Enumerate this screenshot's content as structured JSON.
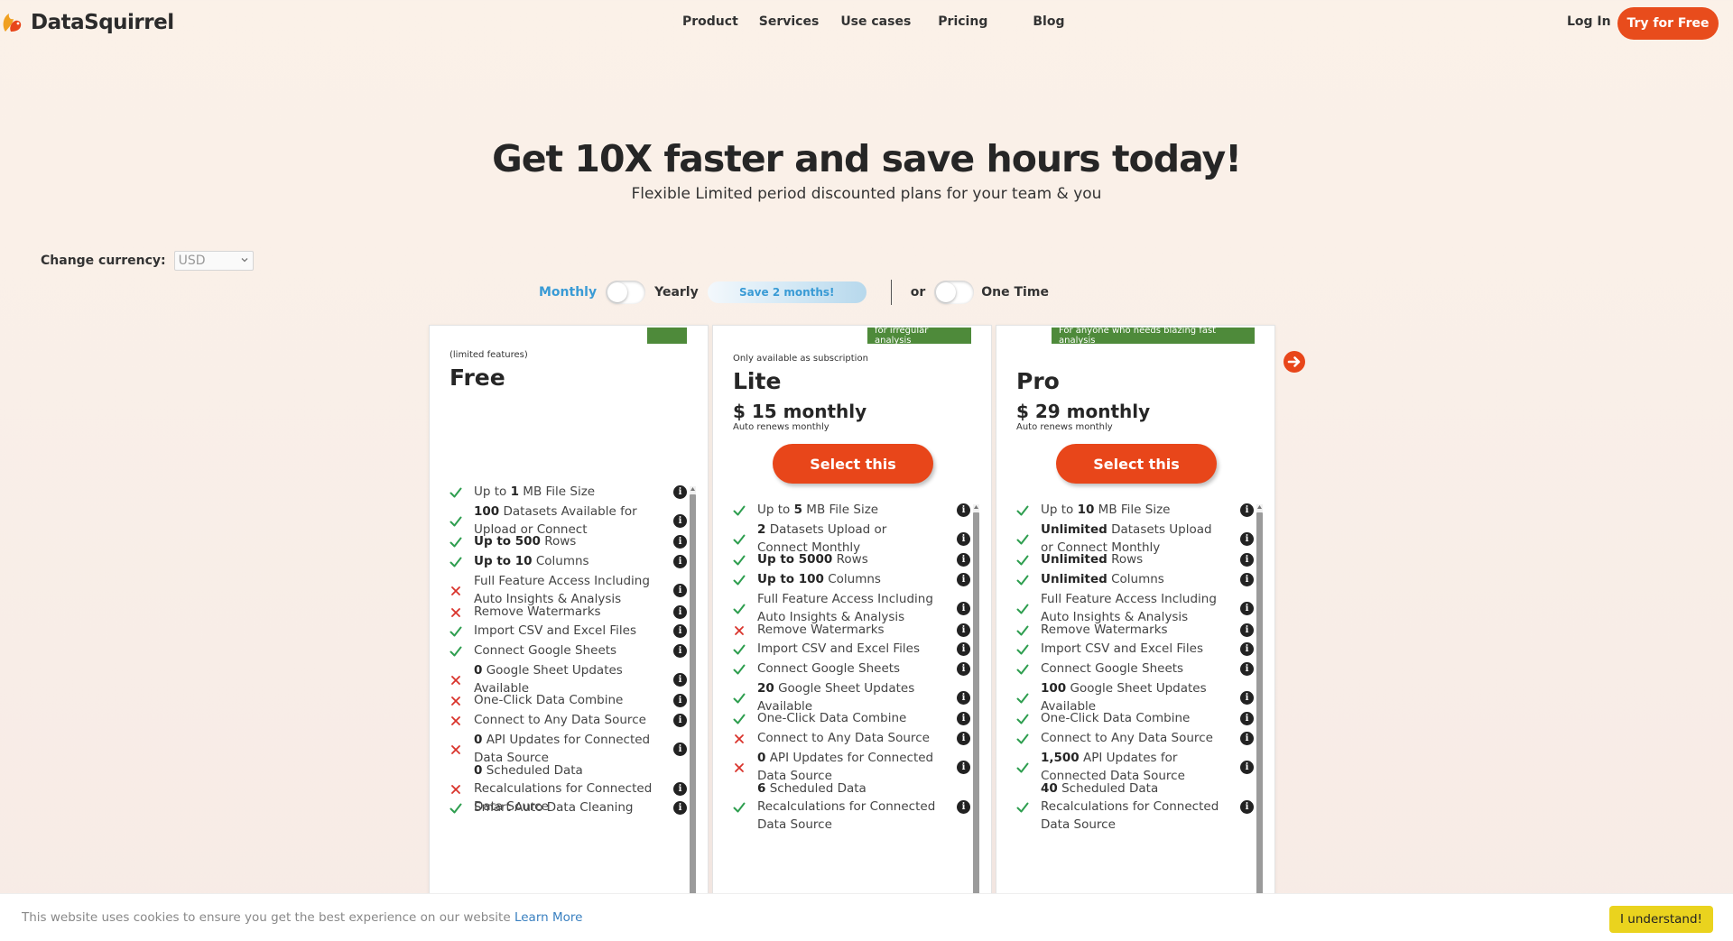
{
  "brand": {
    "name": "DataSquirrel"
  },
  "nav": {
    "items": [
      "Product",
      "Services",
      "Use cases",
      "Pricing",
      "Blog"
    ],
    "login": "Log In",
    "cta": "Try for Free"
  },
  "hero": {
    "title": "Get 10X faster and save hours today!",
    "subtitle": "Flexible Limited period discounted plans for your team & you"
  },
  "currency": {
    "label": "Change currency:",
    "value": "USD"
  },
  "billing": {
    "monthly": "Monthly",
    "yearly": "Yearly",
    "save_badge": "Save 2 months!",
    "or": "or",
    "one_time": "One Time"
  },
  "plans": [
    {
      "badge": "",
      "note": "(limited features)",
      "name": "Free",
      "features": [
        {
          "ok": true,
          "pre": "Up to ",
          "bold": "1",
          "post": " MB File Size"
        },
        {
          "ok": true,
          "pre": "",
          "bold": "100",
          "post": " Datasets Available for Upload or Connect"
        },
        {
          "ok": true,
          "pre": "",
          "bold": "Up to 500",
          "post": " Rows"
        },
        {
          "ok": true,
          "pre": "",
          "bold": "Up to 10",
          "post": " Columns"
        },
        {
          "ok": false,
          "pre": "Full Feature Access Including Auto Insights & Analysis",
          "bold": "",
          "post": ""
        },
        {
          "ok": false,
          "pre": "Remove Watermarks",
          "bold": "",
          "post": ""
        },
        {
          "ok": true,
          "pre": "Import CSV and Excel Files",
          "bold": "",
          "post": ""
        },
        {
          "ok": true,
          "pre": "Connect Google Sheets",
          "bold": "",
          "post": ""
        },
        {
          "ok": false,
          "pre": "",
          "bold": "0",
          "post": " Google Sheet Updates Available"
        },
        {
          "ok": false,
          "pre": "One-Click Data Combine",
          "bold": "",
          "post": ""
        },
        {
          "ok": false,
          "pre": "Connect to Any Data Source",
          "bold": "",
          "post": ""
        },
        {
          "ok": false,
          "pre": "",
          "bold": "0",
          "post": " API Updates for Connected Data Source"
        },
        {
          "ok": false,
          "pre": "",
          "bold": "0",
          "post": " Scheduled Data Recalculations for Connected Data Source"
        },
        {
          "ok": true,
          "pre": "Smart Auto Data Cleaning",
          "bold": "",
          "post": ""
        }
      ]
    },
    {
      "badge": "for irregular analysis",
      "note": "Only available as subscription",
      "name": "Lite",
      "price": "$ 15 monthly",
      "renew": "Auto renews monthly",
      "button": "Select this",
      "features": [
        {
          "ok": true,
          "pre": "Up to ",
          "bold": "5",
          "post": " MB File Size"
        },
        {
          "ok": true,
          "pre": "",
          "bold": "2",
          "post": " Datasets Upload or Connect Monthly"
        },
        {
          "ok": true,
          "pre": "",
          "bold": "Up to 5000",
          "post": " Rows"
        },
        {
          "ok": true,
          "pre": "",
          "bold": "Up to 100",
          "post": " Columns"
        },
        {
          "ok": true,
          "pre": "Full Feature Access Including Auto Insights & Analysis",
          "bold": "",
          "post": ""
        },
        {
          "ok": false,
          "pre": "Remove Watermarks",
          "bold": "",
          "post": ""
        },
        {
          "ok": true,
          "pre": "Import CSV and Excel Files",
          "bold": "",
          "post": ""
        },
        {
          "ok": true,
          "pre": "Connect Google Sheets",
          "bold": "",
          "post": ""
        },
        {
          "ok": true,
          "pre": "",
          "bold": "20",
          "post": " Google Sheet Updates Available"
        },
        {
          "ok": true,
          "pre": "One-Click Data Combine",
          "bold": "",
          "post": ""
        },
        {
          "ok": false,
          "pre": "Connect to Any Data Source",
          "bold": "",
          "post": ""
        },
        {
          "ok": false,
          "pre": "",
          "bold": "0",
          "post": " API Updates for Connected Data Source"
        },
        {
          "ok": true,
          "pre": "",
          "bold": "6",
          "post": " Scheduled Data Recalculations for Connected Data Source"
        }
      ]
    },
    {
      "badge": "For anyone who needs blazing fast analysis",
      "note": "",
      "name": "Pro",
      "price": "$ 29 monthly",
      "renew": "Auto renews monthly",
      "button": "Select this",
      "features": [
        {
          "ok": true,
          "pre": "Up to ",
          "bold": "10",
          "post": " MB File Size"
        },
        {
          "ok": true,
          "pre": "",
          "bold": "Unlimited",
          "post": " Datasets Upload or Connect Monthly"
        },
        {
          "ok": true,
          "pre": "",
          "bold": "Unlimited",
          "post": " Rows"
        },
        {
          "ok": true,
          "pre": "",
          "bold": "Unlimited",
          "post": " Columns"
        },
        {
          "ok": true,
          "pre": "Full Feature Access Including Auto Insights & Analysis",
          "bold": "",
          "post": ""
        },
        {
          "ok": true,
          "pre": "Remove Watermarks",
          "bold": "",
          "post": ""
        },
        {
          "ok": true,
          "pre": "Import CSV and Excel Files",
          "bold": "",
          "post": ""
        },
        {
          "ok": true,
          "pre": "Connect Google Sheets",
          "bold": "",
          "post": ""
        },
        {
          "ok": true,
          "pre": "",
          "bold": "100",
          "post": " Google Sheet Updates Available"
        },
        {
          "ok": true,
          "pre": "One-Click Data Combine",
          "bold": "",
          "post": ""
        },
        {
          "ok": true,
          "pre": "Connect to Any Data Source",
          "bold": "",
          "post": ""
        },
        {
          "ok": true,
          "pre": "",
          "bold": "1,500",
          "post": " API Updates for Connected Data Source"
        },
        {
          "ok": true,
          "pre": "",
          "bold": "40",
          "post": " Scheduled Data Recalculations for Connected Data Source"
        }
      ]
    }
  ],
  "cookie": {
    "text": "This website uses cookies to ensure you get the best experience on our website",
    "link": "Learn More",
    "button": "I understand!"
  },
  "colors": {
    "accent": "#e8461a",
    "check": "#2e9e4f",
    "cross": "#d9332b",
    "badge": "#4e8a3a",
    "link": "#3a9bd5",
    "cookie_btn": "#ead31e"
  },
  "icons": [
    "squirrel-logo-icon",
    "check-icon",
    "cross-icon",
    "info-icon",
    "arrow-right-circle-icon",
    "chevron-down-icon"
  ]
}
